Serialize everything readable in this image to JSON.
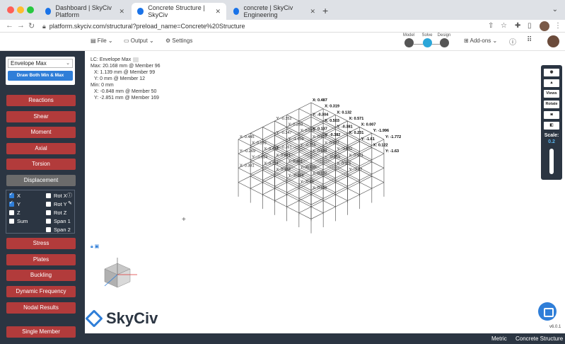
{
  "browser": {
    "tabs": [
      {
        "title": "Dashboard | SkyCiv Platform",
        "active": false
      },
      {
        "title": "Concrete Structure | SkyCiv",
        "active": true
      },
      {
        "title": "concrete | SkyCiv Engineering",
        "active": false
      }
    ],
    "new_tab": "+",
    "url": "platform.skyciv.com/structural?preload_name=Concrete%20Structure"
  },
  "header": {
    "file": "File",
    "output": "Output",
    "settings": "Settings",
    "stages": [
      "Model",
      "Solve",
      "Design"
    ],
    "addons": "Add-ons"
  },
  "sidebar": {
    "envelope": "Envelope Max",
    "draw_both": "Draw Both Min & Max",
    "buttons_top": [
      "Reactions",
      "Shear",
      "Moment",
      "Axial",
      "Torsion",
      "Displacement"
    ],
    "checks": [
      {
        "label": "X",
        "checked": true
      },
      {
        "label": "Y",
        "checked": true
      },
      {
        "label": "Z",
        "checked": false
      },
      {
        "label": "Sum",
        "checked": false
      },
      {
        "label": "Rot X",
        "checked": false
      },
      {
        "label": "Rot Y",
        "checked": false
      },
      {
        "label": "Rot Z",
        "checked": false
      },
      {
        "label": "Span 1",
        "checked": false
      },
      {
        "label": "Span 2",
        "checked": false
      }
    ],
    "buttons_bottom": [
      "Stress",
      "Plates",
      "Buckling",
      "Dynamic Frequency",
      "Nodal Results"
    ],
    "single_member": "Single Member"
  },
  "results": {
    "lc": "LC: Envelope Max",
    "max": "Max: 20.168 mm @ Member 96",
    "max_x": "X: 1.139 mm @ Member 99",
    "max_y": "Y: 0 mm @ Member 12",
    "min": "Min: 0 mm",
    "min_x": "X: -0.848 mm @ Member 50",
    "min_y": "Y: -2.851 mm @ Member 169"
  },
  "model_labels": [
    "X: 0.487",
    "Y: -0.352",
    "X: 0.445",
    "X: 0.319",
    "X: 0.263",
    "X: 0.199",
    "X: 0.132",
    "X: 0.512",
    "X: 0.432",
    "X: 0.571",
    "X: 0.107",
    "X: 0.071",
    "X: 0.007",
    "X: 0.037",
    "X: 0.461",
    "Y: -1.996",
    "Y: -1.502",
    "Y: -0.733",
    "Y: -1.772",
    "X: 0.151",
    "X: 0.107",
    "Y: -0.304",
    "Y: -0.347",
    "Y: -0.269",
    "X: 0.503",
    "Y: -1.609",
    "Y: -1.634",
    "Y: -0.381",
    "Y: -0.355",
    "X: 0.114",
    "X: 0.231",
    "X: 0.148",
    "X: 0.152",
    "Y: -1.61",
    "Y: -0.359",
    "Y: -0.268",
    "X: 0.122",
    "X: 0.116",
    "Y: -0.89",
    "Y: -1.63",
    "Y: -1.37",
    "X: 0.166",
    "X: 0.137",
    "Y: -0.261",
    "X: 0.381",
    "Y: -0.382"
  ],
  "toolbar": {
    "views": "Views",
    "rotate": "Rotate",
    "scale_label": "Scale:",
    "scale_value": "0.2"
  },
  "logo_text": "SkyCiv",
  "version": "v6.0.1",
  "footer": {
    "units": "Metric",
    "project": "Concrete Structure"
  },
  "colors": {
    "sidebar_bg": "#2b3542",
    "result_btn": "#b23b3b",
    "accent": "#2f7ed8"
  }
}
